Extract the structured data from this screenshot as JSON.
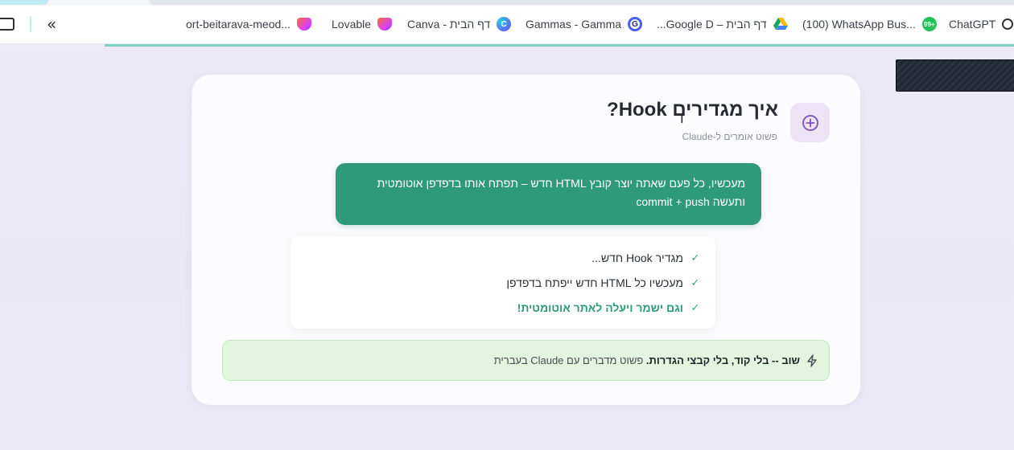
{
  "bookmarks": {
    "items": [
      {
        "label": "ChatGPT",
        "icon": "chatgpt-icon"
      },
      {
        "label": "(100) WhatsApp Bus...",
        "icon": "whatsapp-icon"
      },
      {
        "label": "דף הבית – Google D...",
        "icon": "google-drive-icon"
      },
      {
        "label": "Gammas - Gamma",
        "icon": "gamma-icon"
      },
      {
        "label": "דף הבית - Canva",
        "icon": "canva-icon"
      },
      {
        "label": "Lovable",
        "icon": "lovable-icon"
      },
      {
        "label": "ort-beitarava-meod...",
        "icon": "lovable-icon"
      }
    ],
    "whatsapp_badge": "99+",
    "accent_color": "#7fd1c6"
  },
  "card": {
    "title": "איך מגדירים Hook?",
    "subtitle": "פשוט אומרים ל-Claude",
    "prompt_lines": [
      "מעכשיו, כל פעם שאתה יוצר קובץ HTML חדש – תפתח אותו בדפדפן אוטומטית",
      "ותעשה commit + push"
    ],
    "steps": [
      {
        "text": "מגדיר Hook חדש...",
        "emphasis": false
      },
      {
        "text": "מעכשיו כל HTML חדש ייפתח בדפדפן",
        "emphasis": false
      },
      {
        "text": "וגם ישמר ויעלה לאתר אוטומטית!",
        "emphasis": true
      }
    ],
    "banner": {
      "bold": "שוב -- בלי קוד, בלי קבצי הגדרות.",
      "rest": " פשוט מדברים עם Claude בעברית"
    },
    "colors": {
      "prompt_bg": "#2f9a79",
      "banner_bg": "#e2f6df",
      "check": "#37a37f"
    }
  }
}
